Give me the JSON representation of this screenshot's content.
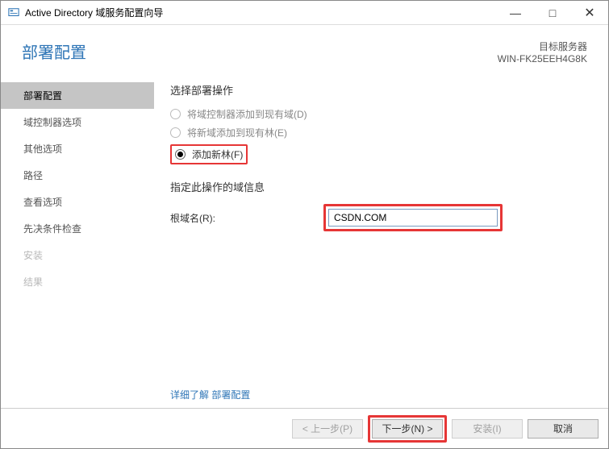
{
  "window": {
    "title": "Active Directory 域服务配置向导"
  },
  "header": {
    "page_title": "部署配置",
    "target_label": "目标服务器",
    "target_value": "WIN-FK25EEH4G8K"
  },
  "sidebar": {
    "items": [
      {
        "label": "部署配置",
        "state": "active"
      },
      {
        "label": "域控制器选项",
        "state": "normal"
      },
      {
        "label": "其他选项",
        "state": "normal"
      },
      {
        "label": "路径",
        "state": "normal"
      },
      {
        "label": "查看选项",
        "state": "normal"
      },
      {
        "label": "先决条件检查",
        "state": "normal"
      },
      {
        "label": "安装",
        "state": "disabled"
      },
      {
        "label": "结果",
        "state": "disabled"
      }
    ]
  },
  "main": {
    "select_op_label": "选择部署操作",
    "radios": [
      {
        "label": "将域控制器添加到现有域(D)",
        "checked": false,
        "disabled": true
      },
      {
        "label": "将新域添加到现有林(E)",
        "checked": false,
        "disabled": true
      },
      {
        "label": "添加新林(F)",
        "checked": true,
        "disabled": false
      }
    ],
    "domain_info_label": "指定此操作的域信息",
    "root_domain_label": "根域名(R):",
    "root_domain_value": "CSDN.COM",
    "learn_more": "详细了解 部署配置"
  },
  "footer": {
    "prev": "< 上一步(P)",
    "next": "下一步(N) >",
    "install": "安装(I)",
    "cancel": "取消"
  }
}
